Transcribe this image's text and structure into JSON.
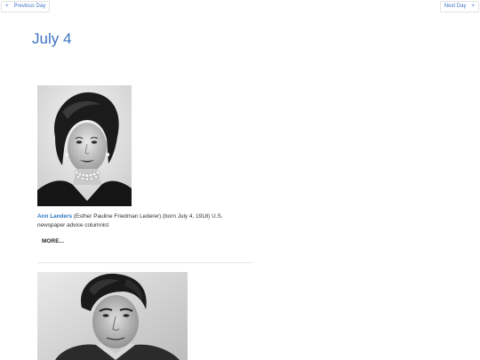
{
  "nav": {
    "prev_label": "Previous Day",
    "next_label": "Next Day",
    "prev_chevron": "<",
    "next_chevron": ">"
  },
  "page": {
    "title": "July 4"
  },
  "entries": [
    {
      "name": "Ann Landers",
      "description": " (Esther Pauline Friedman Lederer) (born July 4, 1918) U.S. newspaper advice columnist",
      "more_label": "MORE...",
      "photo_icon": "portrait-photo"
    },
    {
      "photo_icon": "portrait-photo"
    }
  ],
  "colors": {
    "link": "#3f76c9",
    "title": "#3d72c4",
    "name": "#2f76c3",
    "text": "#333333"
  }
}
